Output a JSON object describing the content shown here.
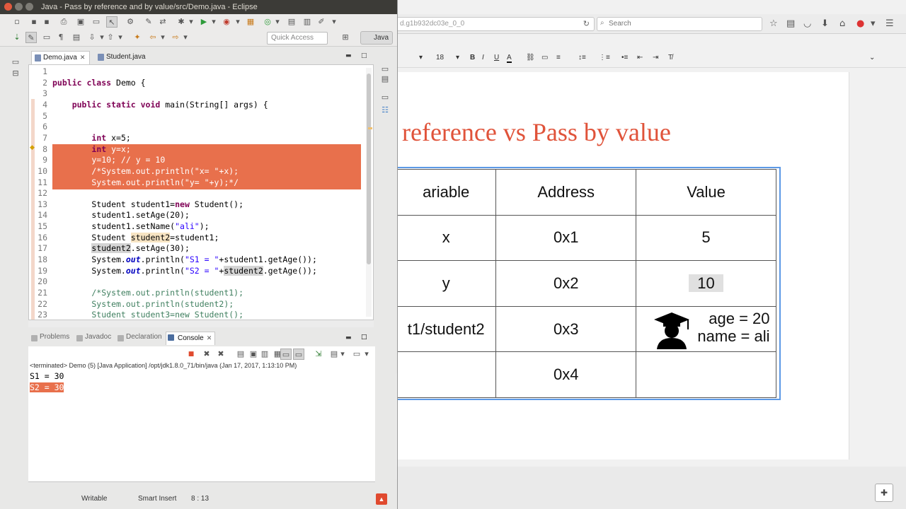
{
  "eclipse": {
    "window_title": "Java - Pass by reference and by value/src/Demo.java - Eclipse",
    "quick_access_placeholder": "Quick Access",
    "perspective": "Java",
    "editor_tabs": [
      {
        "label": "Demo.java",
        "active": true
      },
      {
        "label": "Student.java",
        "active": false
      }
    ],
    "code_lines": [
      {
        "n": "1"
      },
      {
        "n": "2"
      },
      {
        "n": "3"
      },
      {
        "n": "4"
      },
      {
        "n": "5"
      },
      {
        "n": "6"
      },
      {
        "n": "7"
      },
      {
        "n": "8"
      },
      {
        "n": "9"
      },
      {
        "n": "10"
      },
      {
        "n": "11"
      },
      {
        "n": "12"
      },
      {
        "n": "13"
      },
      {
        "n": "14"
      },
      {
        "n": "15"
      },
      {
        "n": "16"
      },
      {
        "n": "17"
      },
      {
        "n": "18"
      },
      {
        "n": "19"
      },
      {
        "n": "20"
      },
      {
        "n": "21"
      },
      {
        "n": "22"
      },
      {
        "n": "23"
      }
    ],
    "code": {
      "l2_kw": "public class",
      "l2_rest": " Demo {",
      "l4_kw": "public static void",
      "l4_rest": " main(String[] args) {",
      "l7_kw": "int",
      "l7_rest": " x=5;",
      "l8_kw": "int",
      "l8_rest": " y=x;",
      "l9": "y=10; // y = 10",
      "l10": "/*System.out.println(\"x= \"+x);",
      "l11": "System.out.println(\"y= \"+y);*/",
      "l13_a": "Student student1=",
      "l13_kw": "new",
      "l13_b": " Student();",
      "l14": "student1.setAge(20);",
      "l15_a": "student1.setName(",
      "l15_str": "\"ali\"",
      "l15_b": ");",
      "l16_a": "Student ",
      "l16_occ": "student2",
      "l16_b": "=student1;",
      "l17_occ": "student2",
      "l17_b": ".setAge(30);",
      "l18_a": "System.",
      "l18_fld": "out",
      "l18_b": ".println(",
      "l18_str": "\"S1 = \"",
      "l18_c": "+student1.getAge());",
      "l19_a": "System.",
      "l19_fld": "out",
      "l19_b": ".println(",
      "l19_str": "\"S2 = \"",
      "l19_c": "+",
      "l19_occ": "student2",
      "l19_d": ".getAge());",
      "l21": "/*System.out.println(student1);",
      "l22": "System.out.println(student2);",
      "l23": "Student student3=new Student();"
    },
    "views_tabs": [
      {
        "label": "Problems",
        "active": false
      },
      {
        "label": "Javadoc",
        "active": false
      },
      {
        "label": "Declaration",
        "active": false
      },
      {
        "label": "Console",
        "active": true
      }
    ],
    "console_header": "<terminated> Demo (5) [Java Application] /opt/jdk1.8.0_71/bin/java (Jan 17, 2017, 1:13:10 PM)",
    "console_lines": [
      "S1 = 30",
      "S2 = 30"
    ],
    "status": {
      "writable": "Writable",
      "insert_mode": "Smart Insert",
      "position": "8 : 13"
    }
  },
  "browser": {
    "url": "d.g1b932dc03e_0_0",
    "search_placeholder": "Search",
    "font_size": "18"
  },
  "slide": {
    "title": "reference vs Pass by value",
    "table": {
      "headers": [
        "ariable",
        "Address",
        "Value"
      ],
      "rows": [
        [
          "x",
          "0x1",
          "5"
        ],
        [
          "y",
          "0x2",
          "10"
        ],
        [
          "t1/student2",
          "0x3",
          ""
        ],
        [
          "",
          "0x4",
          ""
        ]
      ],
      "student_age": "age =  20",
      "student_name": "name =  ali"
    }
  },
  "colors": {
    "selection": "#e8704c",
    "slide_title": "#e0533a",
    "table_frame": "#5c99e6"
  }
}
